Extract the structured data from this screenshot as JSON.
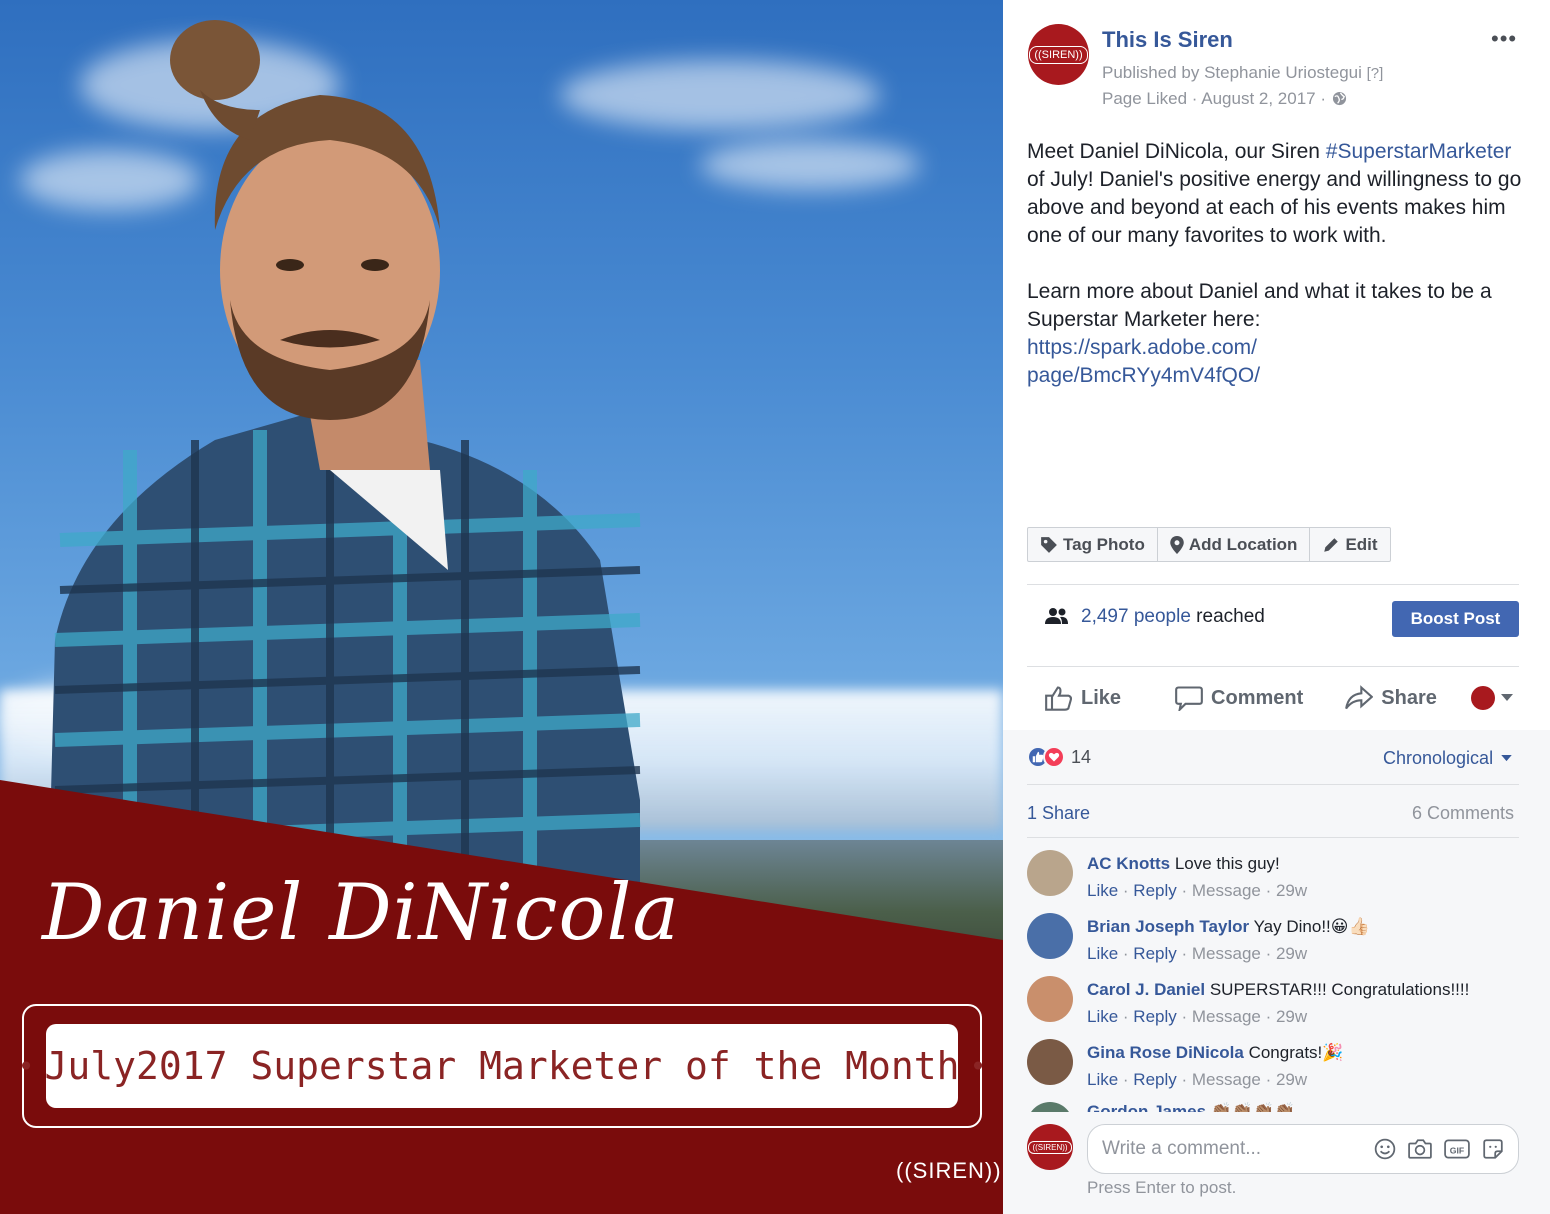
{
  "photo": {
    "name_script": "Daniel DiNicola",
    "banner_text": "July2017 Superstar Marketer of the Month",
    "banner_bullet": "•",
    "logo_text": "((SIREN))",
    "band_color": "#7a0c0c"
  },
  "post": {
    "avatar_text": "((SIREN))",
    "page_name": "This Is Siren",
    "published_by": "Published by Stephanie Uriostegui",
    "help_marker": "[?]",
    "page_liked": "Page Liked · August 2, 2017 ·",
    "more": "•••",
    "text_1a": "Meet Daniel DiNicola, our Siren ",
    "hashtag": "#SuperstarMarketer",
    "text_1b": " of July! Daniel's positive energy and willingness to go above and beyond at each of his events makes him one of our many favorites to work with.",
    "text_2": "Learn more about Daniel and what it takes to be a Superstar Marketer here:",
    "link_1": "https://spark.adobe.com/",
    "link_2": "page/BmcRYy4mV4fQO/"
  },
  "photo_actions": {
    "tag": "Tag Photo",
    "location": "Add Location",
    "edit": "Edit"
  },
  "reach": {
    "count": "2,497 people",
    "suffix": " reached",
    "boost": "Boost Post"
  },
  "actions": {
    "like": "Like",
    "comment": "Comment",
    "share": "Share"
  },
  "reactions": {
    "count": "14",
    "sort": "Chronological",
    "shares": "1 Share",
    "comments": "6 Comments"
  },
  "comments": [
    {
      "name": "AC Knotts",
      "text": "Love this guy!",
      "like": "Like",
      "reply": "Reply",
      "message": "Message",
      "time": "29w",
      "avatar_color": "#b9a58c"
    },
    {
      "name": "Brian Joseph Taylor",
      "text": "Yay Dino!!😀👍🏻",
      "like": "Like",
      "reply": "Reply",
      "message": "Message",
      "time": "29w",
      "avatar_color": "#4a6fa8"
    },
    {
      "name": "Carol J. Daniel",
      "text": "SUPERSTAR!!! Congratulations!!!!",
      "like": "Like",
      "reply": "Reply",
      "message": "Message",
      "time": "29w",
      "avatar_color": "#c98f6c"
    },
    {
      "name": "Gina Rose DiNicola",
      "text": "Congrats!🎉",
      "like": "Like",
      "reply": "Reply",
      "message": "Message",
      "time": "29w",
      "avatar_color": "#7a5a45"
    }
  ],
  "partial_comment": "Gordon James 👏🏽👏🏽👏🏽👏🏽",
  "write": {
    "placeholder": "Write a comment...",
    "hint": "Press Enter to post.",
    "avatar_text": "((SIREN))",
    "gif_label": "GIF"
  }
}
